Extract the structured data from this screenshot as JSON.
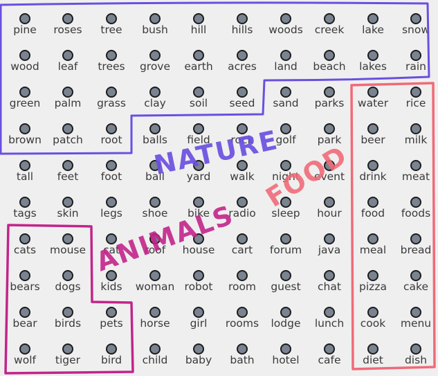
{
  "words": [
    [
      "pine",
      "roses",
      "tree",
      "bush",
      "hill",
      "hills",
      "woods",
      "creek",
      "lake",
      "snow"
    ],
    [
      "wood",
      "leaf",
      "trees",
      "grove",
      "earth",
      "acres",
      "land",
      "beach",
      "lakes",
      "rain"
    ],
    [
      "green",
      "palm",
      "grass",
      "clay",
      "soil",
      "seed",
      "sand",
      "parks",
      "water",
      "rice"
    ],
    [
      "brown",
      "patch",
      "root",
      "balls",
      "field",
      "rock",
      "golf",
      "park",
      "beer",
      "milk"
    ],
    [
      "tall",
      "feet",
      "foot",
      "ball",
      "yard",
      "walk",
      "night",
      "event",
      "drink",
      "meat"
    ],
    [
      "tags",
      "skin",
      "legs",
      "shoe",
      "bike",
      "radio",
      "sleep",
      "hour",
      "food",
      "foods"
    ],
    [
      "cats",
      "mouse",
      "cat",
      "roof",
      "house",
      "cart",
      "forum",
      "java",
      "meal",
      "bread"
    ],
    [
      "bears",
      "dogs",
      "kids",
      "woman",
      "robot",
      "room",
      "guest",
      "chat",
      "pizza",
      "cake"
    ],
    [
      "bear",
      "birds",
      "pets",
      "horse",
      "girl",
      "rooms",
      "lodge",
      "lunch",
      "cook",
      "menu"
    ],
    [
      "wolf",
      "tiger",
      "bird",
      "child",
      "baby",
      "bath",
      "hotel",
      "cafe",
      "diet",
      "dish"
    ]
  ],
  "annotations": {
    "nature": "NATURE",
    "food": "FOOD",
    "animals": "ANIMALS"
  },
  "colors": {
    "background": "#efefef",
    "nature": "#6a4fe0",
    "food": "#f06a78",
    "animals": "#c2248a",
    "dot_fill": "#7a8390",
    "dot_border": "#1c1c1c",
    "text": "#3a3a3a"
  }
}
